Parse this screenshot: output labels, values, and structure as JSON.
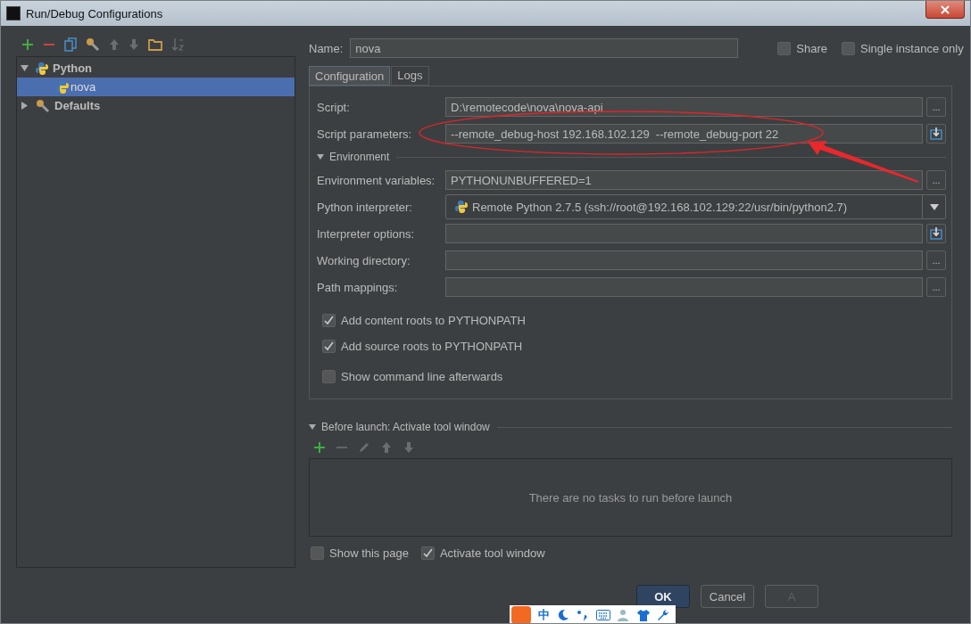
{
  "window": {
    "title": "Run/Debug Configurations"
  },
  "tree": [
    {
      "label": "Python",
      "kind": "python",
      "expanded": true,
      "selected": false,
      "children": [
        {
          "label": "nova",
          "kind": "python",
          "selected": true
        }
      ]
    },
    {
      "label": "Defaults",
      "kind": "wrench",
      "expanded": false,
      "selected": false
    }
  ],
  "name_field": {
    "label": "Name:",
    "value": "nova"
  },
  "options": [
    {
      "label": "Share",
      "checked": false
    },
    {
      "label": "Single instance only",
      "checked": false
    }
  ],
  "tabs": [
    {
      "label": "Configuration",
      "selected": true
    },
    {
      "label": "Logs",
      "selected": false
    }
  ],
  "fields_top": [
    {
      "label": "Script:",
      "value": "D:\\remotecode\\nova\\nova-api",
      "kind": "text",
      "button": {
        "kind": "ellipsis",
        "label": "..."
      }
    },
    {
      "label": "Script parameters:",
      "value": "--remote_debug-host 192.168.102.129  --remote_debug-port 22",
      "kind": "text",
      "button": {
        "kind": "expand"
      }
    }
  ],
  "environment": {
    "label": "Environment",
    "expanded": true
  },
  "fields_env": [
    {
      "label": "Environment variables:",
      "value": "PYTHONUNBUFFERED=1",
      "kind": "text",
      "button": {
        "kind": "ellipsis",
        "label": "..."
      }
    },
    {
      "label": "Python interpreter:",
      "value": "Remote Python 2.7.5 (ssh://root@192.168.102.129:22/usr/bin/python2.7)",
      "kind": "dropdown"
    },
    {
      "label": "Interpreter options:",
      "kind": "text",
      "button": {
        "kind": "expand"
      }
    },
    {
      "label": "Working directory:",
      "kind": "text",
      "button": {
        "kind": "ellipsis",
        "label": "..."
      }
    },
    {
      "label": "Path mappings:",
      "kind": "text",
      "button": {
        "kind": "ellipsis",
        "label": "..."
      }
    }
  ],
  "checkboxes": [
    {
      "label": "Add content roots to PYTHONPATH",
      "checked": true
    },
    {
      "label": "Add source roots to PYTHONPATH",
      "checked": true
    },
    {
      "label": "Show command line afterwards",
      "checked": false
    }
  ],
  "before_launch": {
    "label": "Before launch: Activate tool window",
    "expanded": true,
    "empty_message": "There are no tasks to run before launch"
  },
  "bottom_checks": [
    {
      "label": "Show this page",
      "checked": false
    },
    {
      "label": "Activate tool window",
      "checked": true
    }
  ],
  "buttons": [
    {
      "label": "OK",
      "kind": "default",
      "disabled": false
    },
    {
      "label": "Cancel",
      "kind": "normal",
      "disabled": false
    },
    {
      "label": "A",
      "kind": "normal",
      "disabled": true
    }
  ],
  "ime_toolbar": {
    "mode": "中"
  }
}
